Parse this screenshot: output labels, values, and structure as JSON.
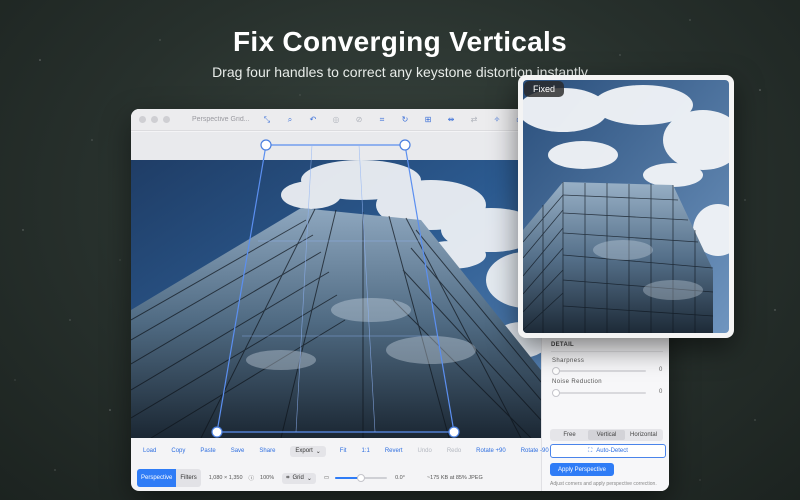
{
  "hero": {
    "title": "Fix Converging Verticals",
    "subtitle": "Drag four handles to correct any keystone distortion instantly"
  },
  "window": {
    "title": "Perspective Grid...",
    "toolbar_icons": [
      "arrows-icon",
      "zoom-icon",
      "undo-icon",
      "circle-icon",
      "slash-circle-icon",
      "crop-icon",
      "rotate-icon",
      "grid-transform-icon",
      "flip-icon",
      "swap-icon",
      "magic-icon",
      "ruler-icon"
    ]
  },
  "sidebar": {
    "detail_title": "DETAIL",
    "sharpness": {
      "label": "Sharpness",
      "value": "0"
    },
    "noise": {
      "label": "Noise Reduction",
      "value": "0"
    },
    "segments": [
      "Free",
      "Vertical",
      "Horizontal"
    ],
    "active_segment": "Vertical",
    "auto_detect": "Auto-Detect",
    "apply": "Apply Perspective",
    "hint": "Adjust corners and apply perspective correction."
  },
  "actions": {
    "load": "Load",
    "copy": "Copy",
    "paste": "Paste",
    "save": "Save",
    "share": "Share",
    "export": "Export",
    "fit": "Fit",
    "one_to_one": "1:1",
    "revert": "Revert",
    "undo": "Undo",
    "redo": "Redo",
    "rotate_plus": "Rotate +90",
    "rotate_minus": "Rotate -90"
  },
  "status": {
    "tab_perspective": "Perspective",
    "tab_filters": "Filters",
    "dimensions": "1,080 × 1,350",
    "zoom": "100%",
    "grid": "Grid",
    "angle": "0.0°",
    "filesize": "~175 KB at 85% JPEG",
    "zoom_slider_fraction": 0.5
  },
  "preview": {
    "badge": "Fixed"
  },
  "colors": {
    "accent": "#2f7cf6",
    "grid_line": "#5b8ff0"
  }
}
